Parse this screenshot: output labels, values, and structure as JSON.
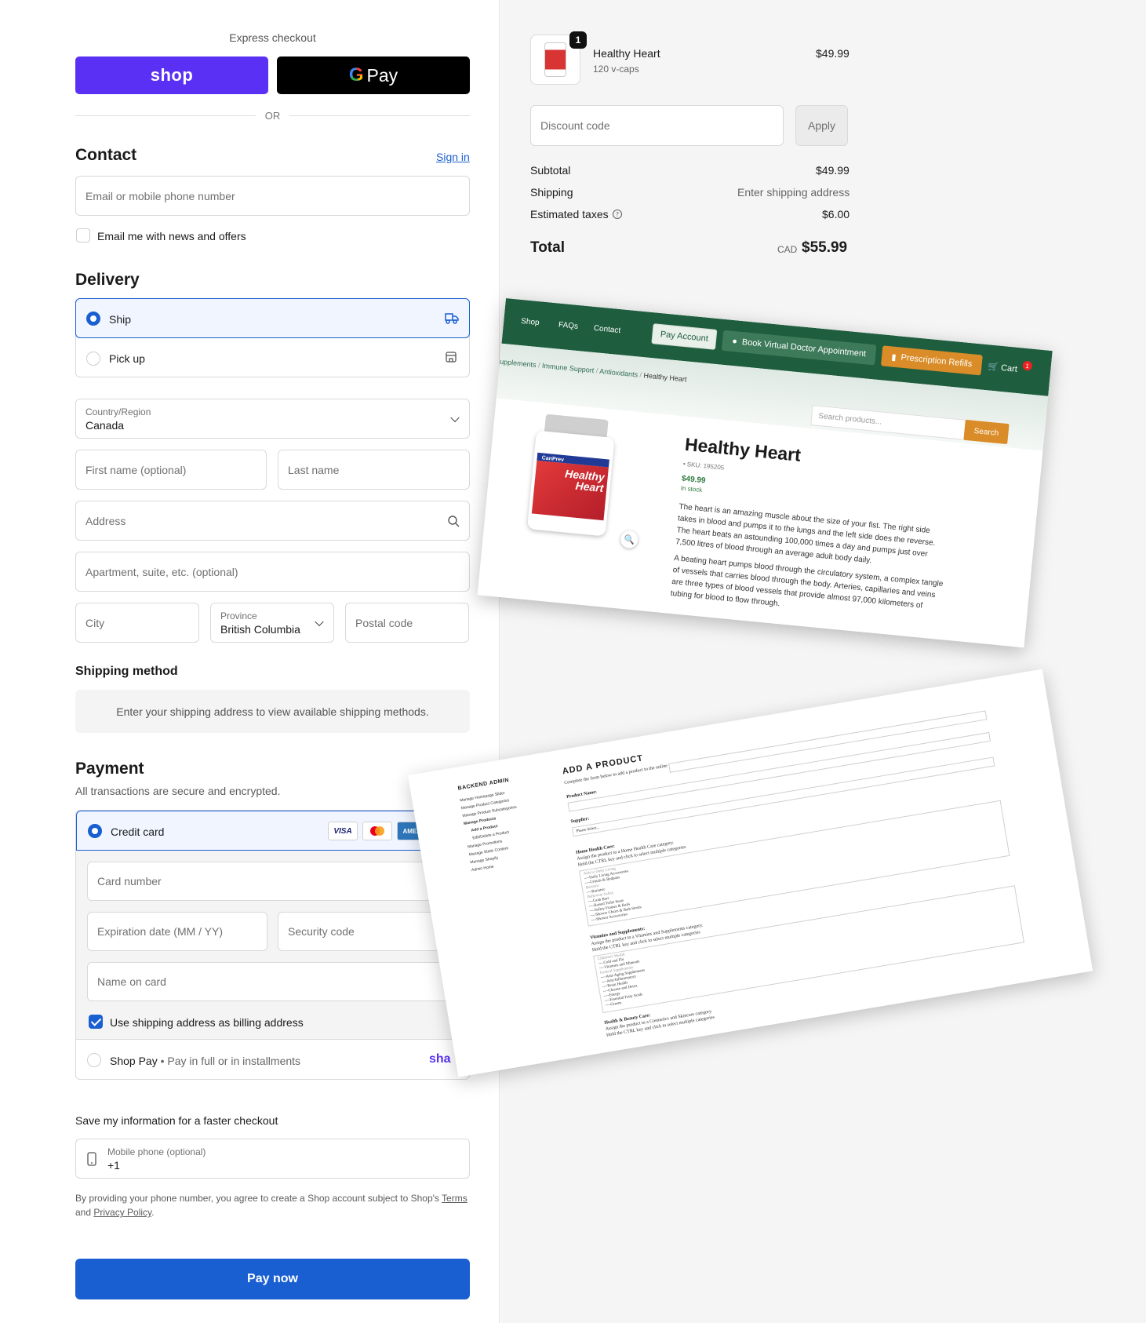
{
  "express": {
    "label": "Express checkout",
    "shop_label": "shop",
    "gpay_g": "G",
    "gpay_label": "Pay",
    "or_label": "OR"
  },
  "contact": {
    "heading": "Contact",
    "signin": "Sign in",
    "email_placeholder": "Email or mobile phone number",
    "news_label": "Email me with news and offers"
  },
  "delivery": {
    "heading": "Delivery",
    "options": [
      {
        "label": "Ship",
        "selected": true
      },
      {
        "label": "Pick up",
        "selected": false
      }
    ],
    "country_label": "Country/Region",
    "country_value": "Canada",
    "first_name": "First name (optional)",
    "last_name": "Last name",
    "address": "Address",
    "apartment": "Apartment, suite, etc. (optional)",
    "city": "City",
    "province_label": "Province",
    "province_value": "British Columbia",
    "postal": "Postal code"
  },
  "shipping_method": {
    "heading": "Shipping method",
    "note": "Enter your shipping address to view available shipping methods."
  },
  "payment": {
    "heading": "Payment",
    "subtitle": "All transactions are secure and encrypted.",
    "credit_card_label": "Credit card",
    "card_brands": [
      "VISA",
      "MC",
      "AMEX"
    ],
    "card_number": "Card number",
    "expiry": "Expiration date (MM / YY)",
    "security": "Security code",
    "name_on_card": "Name on card",
    "billing_same": "Use shipping address as billing address",
    "shop_pay_label": "Shop Pay",
    "shop_pay_sub": "Pay in full or in installments",
    "shop_pay_logo": "sha"
  },
  "save_info": {
    "heading": "Save my information for a faster checkout",
    "phone_label": "Mobile phone (optional)",
    "phone_value": "+1",
    "fine_print_1": "By providing your phone number, you agree to create a Shop account subject to Shop's ",
    "terms": "Terms",
    "fine_and": "and ",
    "privacy": "Privacy Policy",
    "fine_end": "."
  },
  "pay_now": "Pay now",
  "summary": {
    "item_name": "Healthy Heart",
    "item_variant": "120 v-caps",
    "item_qty": "1",
    "item_price": "$49.99",
    "discount_placeholder": "Discount code",
    "apply": "Apply",
    "subtotal_label": "Subtotal",
    "subtotal_value": "$49.99",
    "shipping_label": "Shipping",
    "shipping_value": "Enter shipping address",
    "taxes_label": "Estimated taxes",
    "taxes_value": "$6.00",
    "total_label": "Total",
    "total_currency": "CAD",
    "total_value": "$55.99"
  },
  "store_preview": {
    "nav": [
      "Shop",
      "FAQs",
      "Contact"
    ],
    "pay_account": "Pay Account",
    "book": "Book Virtual Doctor Appointment",
    "refills": "Prescription Refills",
    "cart": "Cart",
    "cart_count": "1",
    "breadcrumbs": [
      "upplements",
      "Immune Support",
      "Antioxidants",
      "Healthy Heart"
    ],
    "search_placeholder": "Search products...",
    "search_btn": "Search",
    "title": "Healthy Heart",
    "sku": "• SKU: 195205",
    "price": "$49.99",
    "stock": "In stock",
    "label_brand": "CanPrev",
    "label_text": "Healthy Heart",
    "desc_1": "The heart is an amazing muscle about the size of your fist. The right side takes in blood and pumps it to the lungs and the left side does the reverse. The heart beats an astounding 100,000 times a day and pumps just over 7,500 litres of blood through an average adult body daily.",
    "desc_2": "A beating heart pumps blood through the circulatory system, a complex tangle of vessels that carries blood through the body. Arteries, capillaries and veins are three types of blood vessels that provide almost 97,000 kilometers of tubing for blood to flow through."
  },
  "admin_preview": {
    "side_heading": "BACKEND ADMIN",
    "side_items": [
      "Manage Homepage Slider",
      "Manage Product Categories",
      "Manage Product Subcategories",
      "Manage Products",
      "Add a Product",
      "Edit/Delete a Product",
      "Manage Promotions",
      "Manage Static Content",
      "Manage Shopify",
      "Admin Home"
    ],
    "heading": "ADD A PRODUCT",
    "intro": "Complete the form below to add a product to the online store:",
    "product_name": "Product Name:",
    "supplier": "Supplier:",
    "supplier_select": "Please Select...",
    "home_health": "Home Health Care:",
    "home_assign": "Assign the product to a Home Health Care category.",
    "hold_ctrl": "Hold the CTRL key and click to select multiple categories",
    "home_options": [
      "Aids to Daily Living",
      "----Daily Living Accessories",
      "----Urinals & Bedpans",
      "Bariatric",
      "----Bariatric",
      "Bathroom Safety",
      "----Grab Bars",
      "----Raised Toilet Seats",
      "----Safety Frames & Rails",
      "----Shower Chairs & Bath Stools",
      "----Shower Accessories"
    ],
    "vitamins": "Vitamins and Supplements:",
    "vit_assign": "Assign the product to a Vitamins and Supplements category.",
    "vit_options": [
      "Children's Health",
      "----Cold and Flu",
      "----Vitamins and Minerals",
      "General Supplements",
      "----Anti-Aging Supplements",
      "----Anti-Inflammatory",
      "----Brain Health",
      "----Cleanse and Detox",
      "----Energy",
      "----Essential Fatty Acids",
      "----Greens"
    ],
    "beauty": "Health & Beauty Care:",
    "beauty_assign": "Assign the product to a Cosmetics and Skincare category."
  }
}
